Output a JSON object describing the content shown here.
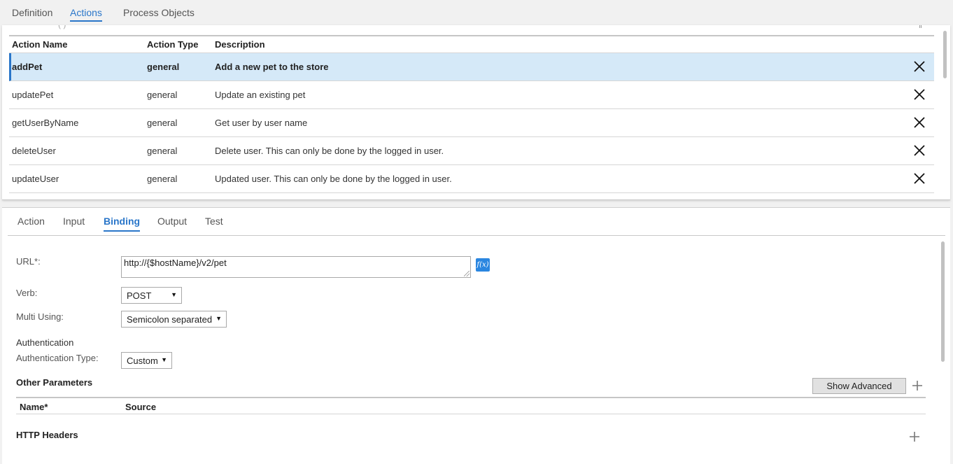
{
  "top_tabs": [
    {
      "label": "Definition",
      "active": false
    },
    {
      "label": "Actions",
      "active": true
    },
    {
      "label": "Process Objects",
      "active": false
    }
  ],
  "actions_table": {
    "headers": {
      "name": "Action Name",
      "type": "Action Type",
      "description": "Description"
    },
    "rows": [
      {
        "name": "addPet",
        "type": "general",
        "description": "Add a new pet to the store",
        "selected": true
      },
      {
        "name": "updatePet",
        "type": "general",
        "description": "Update an existing pet",
        "selected": false
      },
      {
        "name": "getUserByName",
        "type": "general",
        "description": "Get user by user name",
        "selected": false
      },
      {
        "name": "deleteUser",
        "type": "general",
        "description": "Delete user. This can only be done by the logged in user.",
        "selected": false
      },
      {
        "name": "updateUser",
        "type": "general",
        "description": "Updated user. This can only be done by the logged in user.",
        "selected": false
      }
    ],
    "delete_icon": "close-x-icon"
  },
  "sub_tabs": [
    {
      "label": "Action",
      "active": false
    },
    {
      "label": "Input",
      "active": false
    },
    {
      "label": "Binding",
      "active": true
    },
    {
      "label": "Output",
      "active": false
    },
    {
      "label": "Test",
      "active": false
    }
  ],
  "binding": {
    "url_label": "URL*:",
    "url_value": "http://{$hostName}/v2/pet",
    "fx_label": "f(x)",
    "verb_label": "Verb:",
    "verb_value": "POST",
    "multi_using_label": "Multi Using:",
    "multi_using_value": "Semicolon separated",
    "authentication_label": "Authentication",
    "auth_type_label": "Authentication Type:",
    "auth_type_value": "Custom",
    "other_parameters_title": "Other Parameters",
    "show_advanced_label": "Show Advanced",
    "params_headers": {
      "name": "Name*",
      "source": "Source"
    },
    "http_headers_title": "HTTP Headers"
  },
  "colors": {
    "accent": "#2a76c9",
    "selected_row_bg": "#d5e9f8",
    "fx_button": "#2a86e0"
  }
}
